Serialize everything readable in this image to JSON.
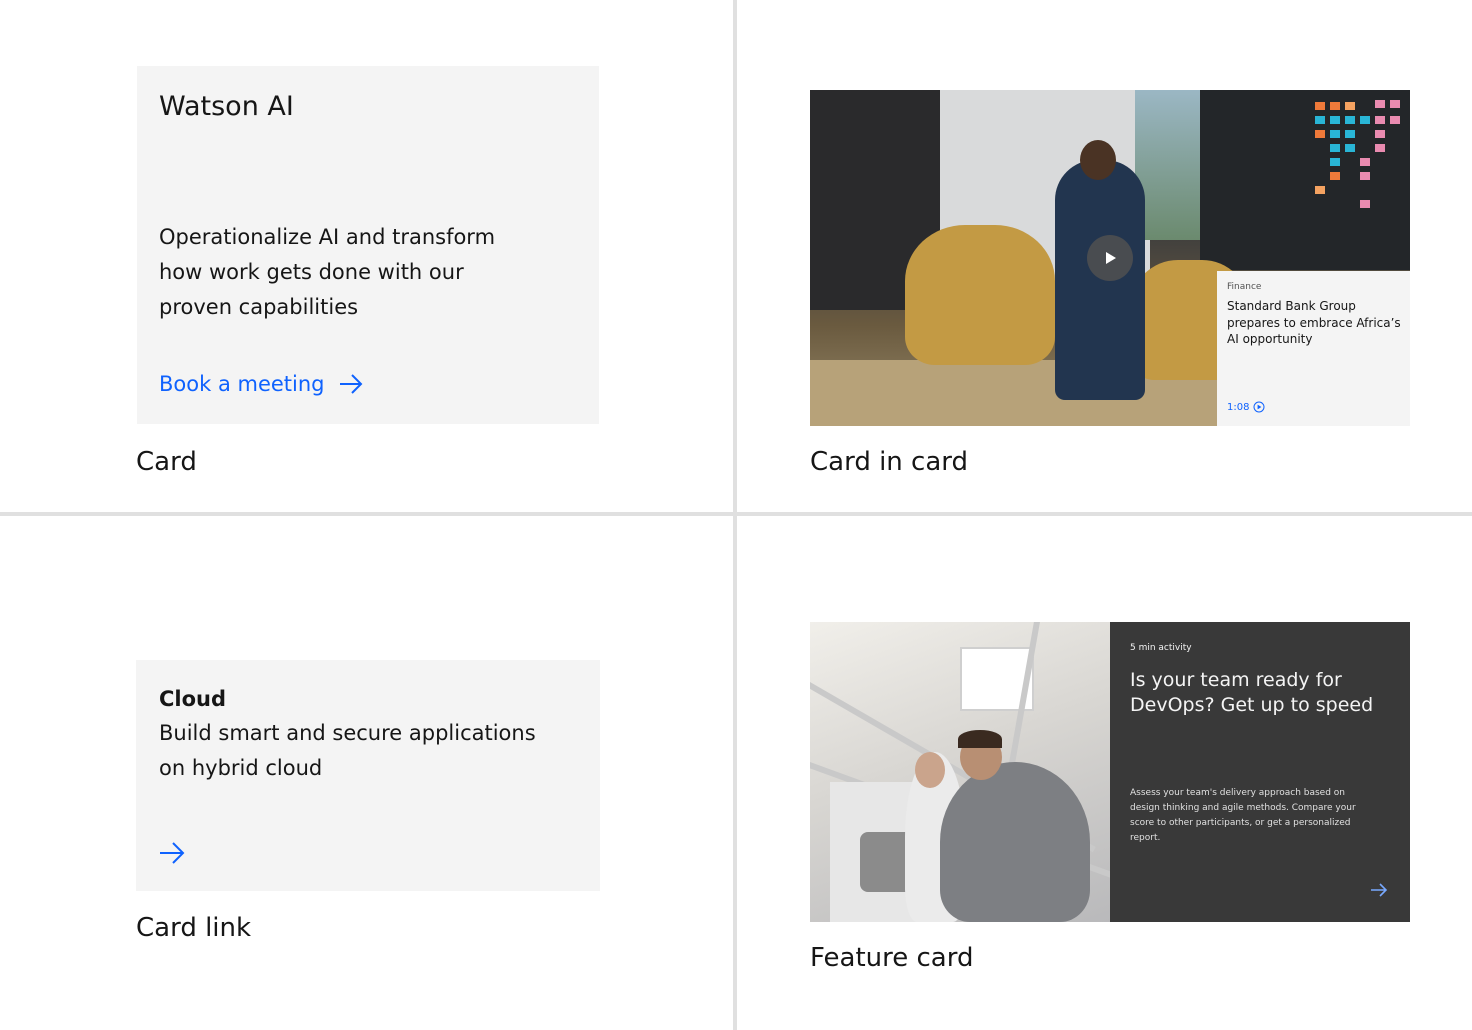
{
  "card": {
    "title": "Watson AI",
    "description": "Operationalize AI and transform how work gets done with our proven capabilities",
    "cta": "Book a meeting",
    "caption": "Card"
  },
  "card_in_card": {
    "eyebrow": "Finance",
    "heading": "Standard Bank Group prepares to embrace Africa’s AI opportunity",
    "duration": "1:08",
    "caption": "Card in card"
  },
  "card_link": {
    "title": "Cloud",
    "description": "Build smart and secure applications on hybrid cloud",
    "caption": "Card link"
  },
  "feature_card": {
    "eyebrow": "5 min activity",
    "heading": "Is your team ready for DevOps? Get up to speed",
    "description": "Assess your team's delivery approach based on design thinking and agile methods. Compare your score to other participants, or get a personalized report.",
    "caption": "Feature card"
  },
  "colors": {
    "link": "#0f62fe",
    "card_bg": "#f4f4f4",
    "feature_panel_bg": "#393939"
  }
}
